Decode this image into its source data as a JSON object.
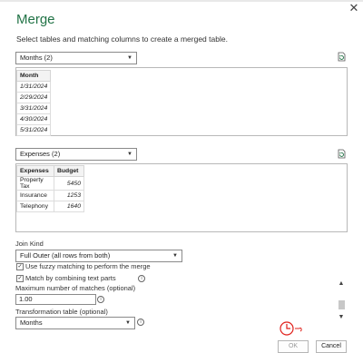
{
  "dialog": {
    "title": "Merge",
    "subtitle": "Select tables and matching columns to create a merged table."
  },
  "first_table": {
    "selected": "Months (2)",
    "header": "Month",
    "rows": [
      "1/31/2024",
      "2/29/2024",
      "3/31/2024",
      "4/30/2024",
      "5/31/2024"
    ]
  },
  "second_table": {
    "selected": "Expenses (2)",
    "headers": [
      "Expenses",
      "Budget"
    ],
    "rows": [
      [
        "Property Tax",
        "5450"
      ],
      [
        "Insurance",
        "1253"
      ],
      [
        "Telephony",
        "1640"
      ]
    ]
  },
  "join": {
    "label": "Join Kind",
    "selected": "Full Outer (all rows from both)"
  },
  "options": {
    "fuzzy_label": "Use fuzzy matching to perform the merge",
    "combine_label": "Match by combining text parts",
    "max_matches_label": "Maximum number of matches (optional)",
    "max_matches_value": "1.00",
    "transform_label": "Transformation table (optional)",
    "transform_value": "Months"
  },
  "buttons": {
    "ok": "OK",
    "cancel": "Cancel"
  },
  "colors": {
    "accent": "#217346",
    "annotation": "#e0201b"
  }
}
